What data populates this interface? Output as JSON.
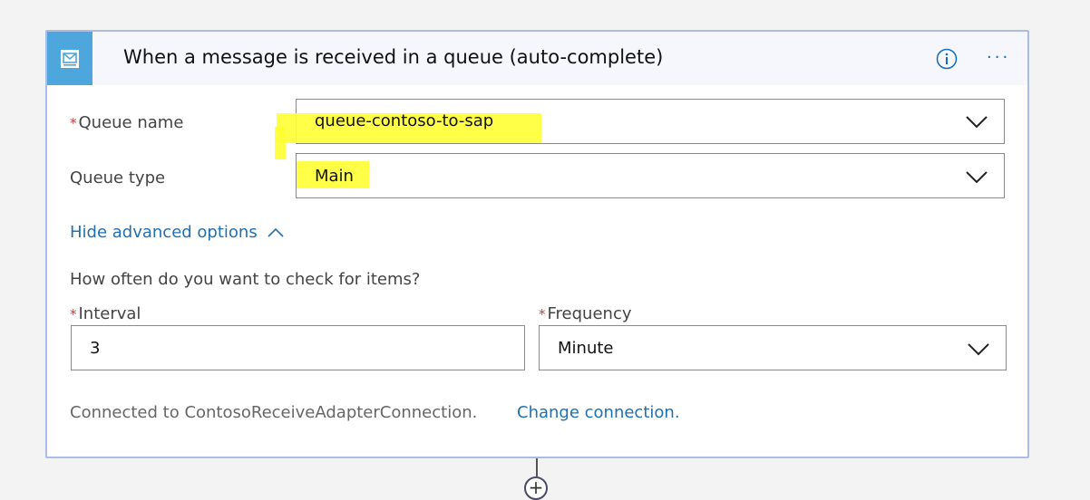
{
  "header": {
    "title": "When a message is received in a queue (auto-complete)",
    "trigger_icon": "service-bus-message-icon",
    "info_icon": "info-icon",
    "more_icon": "more-options-icon",
    "more_glyph": "···"
  },
  "fields": {
    "required_marker": "*",
    "queue_name": {
      "label": "Queue name",
      "value": "queue-contoso-to-sap",
      "required": true
    },
    "queue_type": {
      "label": "Queue type",
      "value": "Main"
    }
  },
  "advanced": {
    "toggle_label": "Hide advanced options",
    "question": "How often do you want to check for items?",
    "interval": {
      "label": "Interval",
      "value": "3",
      "required": true
    },
    "frequency": {
      "label": "Frequency",
      "value": "Minute",
      "required": true
    }
  },
  "connection": {
    "text": "Connected to ContosoReceiveAdapterConnection.",
    "change_link": "Change connection."
  },
  "add_step": {
    "glyph": "+"
  },
  "colors": {
    "accent": "#4da6dc",
    "link": "#1f6fb5",
    "highlight": "#ffff33",
    "card_border": "#a9bde6"
  }
}
